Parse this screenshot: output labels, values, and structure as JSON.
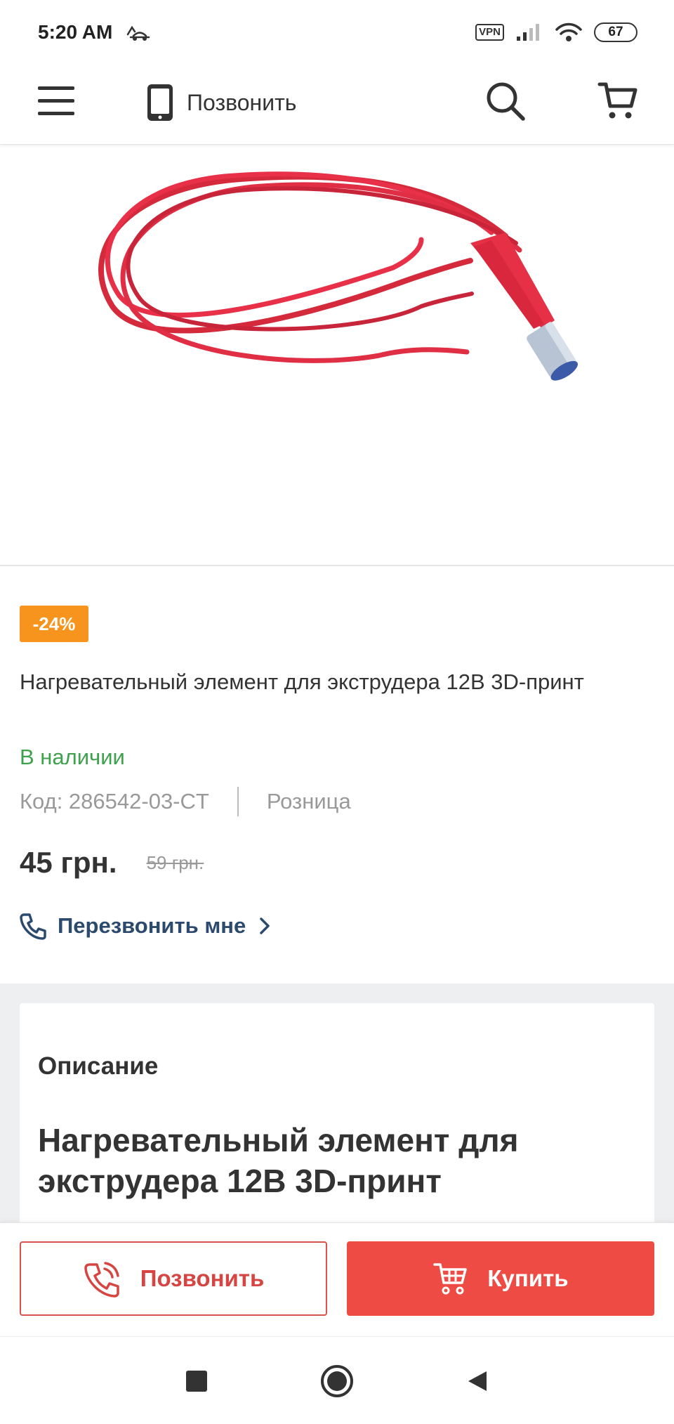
{
  "status_bar": {
    "time": "5:20 AM",
    "vpn": "VPN",
    "battery": "67"
  },
  "header": {
    "call_label": "Позвонить"
  },
  "product": {
    "discount": "-24%",
    "title": "Нагревательный элемент для экструдера 12В 3D-принт",
    "stock": "В наличии",
    "code": "Код: 286542-03-CT",
    "price_type": "Розница",
    "price": "45 грн.",
    "old_price": "59 грн.",
    "callback_label": "Перезвонить мне"
  },
  "description": {
    "heading": "Описание",
    "title": "Нагревательный элемент для экструдера 12В 3D-принт"
  },
  "actions": {
    "call_label": "Позвонить",
    "buy_label": "Купить"
  },
  "colors": {
    "accent": "#ef4b45",
    "discount": "#f7941d",
    "in_stock": "#3ea14b",
    "link": "#2c4a6e"
  },
  "icons": {
    "menu": "hamburger-icon",
    "phone": "smartphone-icon",
    "search": "search-icon",
    "cart": "cart-icon",
    "callback": "phone-icon",
    "chevron": "chevron-right-icon"
  }
}
